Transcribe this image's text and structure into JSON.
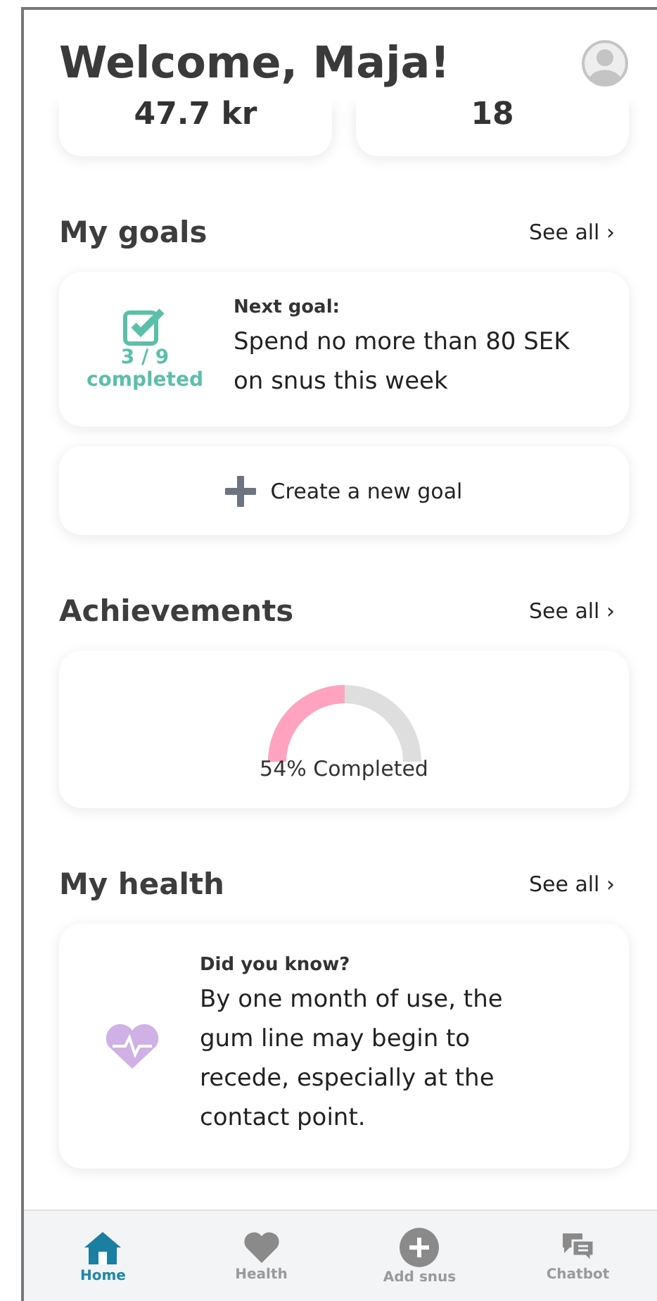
{
  "header": {
    "title": "Welcome, Maja!"
  },
  "stats": [
    {
      "value": "47.7 kr"
    },
    {
      "value": "18"
    }
  ],
  "goals": {
    "title": "My goals",
    "see_all": "See all ›",
    "completed_count": "3 / 9",
    "completed_label": "completed",
    "next_label": "Next goal:",
    "next_text": "Spend no more than 80 SEK on snus this week",
    "create_button": "Create a new goal"
  },
  "achievements": {
    "title": "Achievements",
    "see_all": "See all ›",
    "label": "54% Completed"
  },
  "health": {
    "title": "My health",
    "see_all": "See all ›",
    "fact_label": "Did you know?",
    "fact_text": "By one month of use, the gum line may begin to recede, especially at the contact point."
  },
  "tabs": [
    {
      "kind": "home",
      "label": "Home",
      "selected": true
    },
    {
      "kind": "health",
      "label": "Health",
      "selected": false
    },
    {
      "kind": "add",
      "label": "Add snus",
      "selected": false
    },
    {
      "kind": "chat",
      "label": "Chatbot",
      "selected": false
    }
  ]
}
